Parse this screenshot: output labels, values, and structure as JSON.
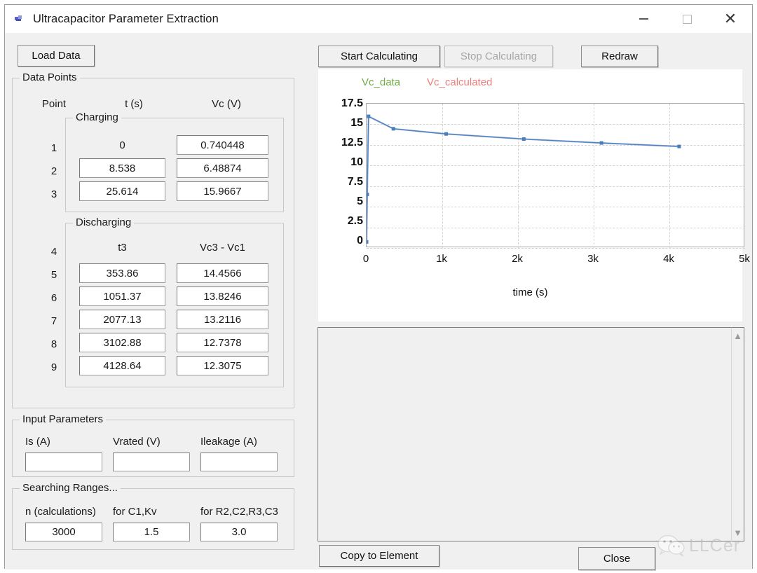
{
  "window": {
    "title": "Ultracapacitor Parameter Extraction",
    "icon": "app-icon",
    "minimize": "—",
    "maximize": "□",
    "close": "✕"
  },
  "toolbar": {
    "load_data": "Load Data",
    "start_calculating": "Start Calculating",
    "stop_calculating": "Stop Calculating",
    "redraw": "Redraw"
  },
  "data_points": {
    "legend": "Data Points",
    "headers": {
      "point": "Point",
      "t": "t (s)",
      "vc": "Vc (V)"
    },
    "charging": {
      "legend": "Charging",
      "rows": [
        {
          "point": "1",
          "t": "0",
          "vc": "0.740448",
          "t_editable": false,
          "vc_editable": true
        },
        {
          "point": "2",
          "t": "8.538",
          "vc": "6.48874",
          "t_editable": true,
          "vc_editable": true
        },
        {
          "point": "3",
          "t": "25.614",
          "vc": "15.9667",
          "t_editable": true,
          "vc_editable": true
        }
      ]
    },
    "discharging": {
      "legend": "Discharging",
      "headers": {
        "t": "t3",
        "vc": "Vc3 - Vc1"
      },
      "header_point": "4",
      "rows": [
        {
          "point": "5",
          "t": "353.86",
          "vc": "14.4566"
        },
        {
          "point": "6",
          "t": "1051.37",
          "vc": "13.8246"
        },
        {
          "point": "7",
          "t": "2077.13",
          "vc": "13.2116"
        },
        {
          "point": "8",
          "t": "3102.88",
          "vc": "12.7378"
        },
        {
          "point": "9",
          "t": "4128.64",
          "vc": "12.3075"
        }
      ]
    }
  },
  "input_parameters": {
    "legend": "Input Parameters",
    "fields": [
      {
        "label": "Is (A)",
        "value": ""
      },
      {
        "label": "Vrated (V)",
        "value": ""
      },
      {
        "label": "Ileakage (A)",
        "value": ""
      }
    ]
  },
  "searching_ranges": {
    "legend": "Searching Ranges...",
    "fields": [
      {
        "label": "n (calculations)",
        "value": "3000"
      },
      {
        "label": "for C1,Kv",
        "value": "1.5"
      },
      {
        "label": "for R2,C2,R3,C3",
        "value": "3.0"
      }
    ]
  },
  "chart_data": {
    "type": "line",
    "title": "",
    "xlabel": "time (s)",
    "ylabel": "",
    "xlim": [
      0,
      5000
    ],
    "ylim": [
      0,
      17.5
    ],
    "xticks": [
      "0",
      "1k",
      "2k",
      "3k",
      "4k",
      "5k"
    ],
    "xtick_values": [
      0,
      1000,
      2000,
      3000,
      4000,
      5000
    ],
    "yticks": [
      "0",
      "2.5",
      "5",
      "7.5",
      "10",
      "12.5",
      "15",
      "17.5"
    ],
    "ytick_values": [
      0,
      2.5,
      5,
      7.5,
      10,
      12.5,
      15,
      17.5
    ],
    "grid": true,
    "legend_position": "top",
    "legend": [
      {
        "name": "Vc_data",
        "color": "#70AD47"
      },
      {
        "name": "Vc_calculated",
        "color": "#ED7D7D"
      }
    ],
    "series": [
      {
        "name": "Vc_data",
        "color": "#4A7EBB",
        "marker": "square",
        "x": [
          0,
          8.538,
          25.614,
          353.86,
          1051.37,
          2077.13,
          3102.88,
          4128.64
        ],
        "y": [
          0.740448,
          6.48874,
          15.9667,
          14.4566,
          13.8246,
          13.2116,
          12.7378,
          12.3075
        ]
      }
    ]
  },
  "log": {
    "text": ""
  },
  "footer": {
    "copy_to_element": "Copy to Element",
    "close": "Close"
  },
  "watermark": {
    "text": "LLCer",
    "icon": "wechat-icon"
  }
}
